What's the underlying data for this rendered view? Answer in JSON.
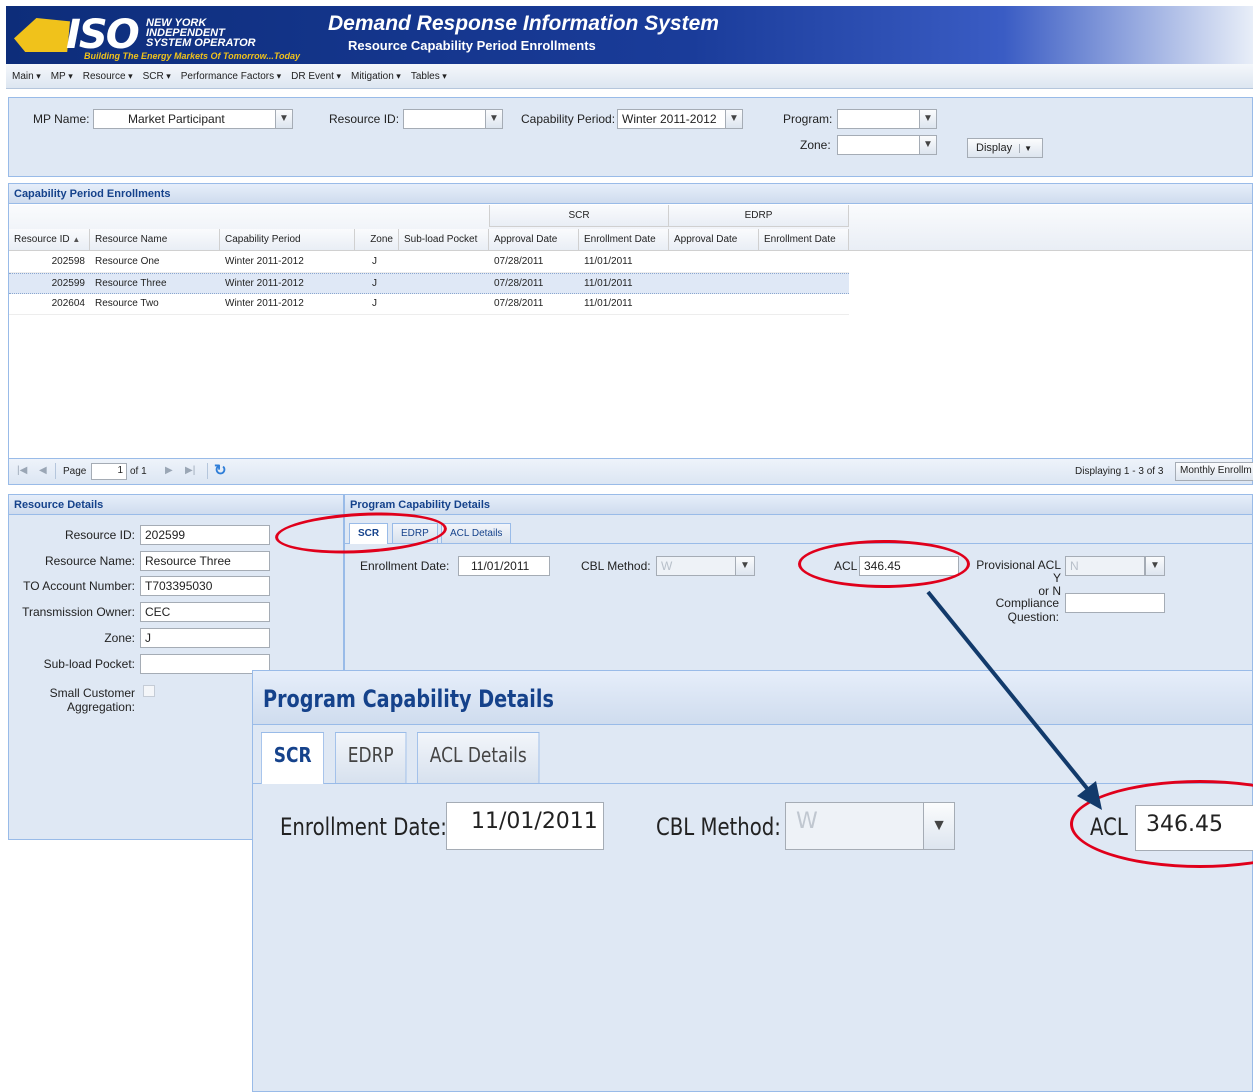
{
  "header": {
    "logo_text": "ISO",
    "logo_org_line1": "NEW YORK",
    "logo_org_line2": "INDEPENDENT",
    "logo_org_line3": "SYSTEM OPERATOR",
    "tagline": "Building The Energy Markets Of Tomorrow...Today",
    "title": "Demand Response Information System",
    "subtitle": "Resource Capability Period Enrollments"
  },
  "menu": [
    "Main",
    "MP",
    "Resource",
    "SCR",
    "Performance Factors",
    "DR Event",
    "Mitigation",
    "Tables"
  ],
  "filter": {
    "mp_label": "MP Name:",
    "mp_value": "Market Participant",
    "resource_label": "Resource ID:",
    "resource_value": "",
    "cap_label": "Capability Period:",
    "cap_value": "Winter 2011-2012",
    "program_label": "Program:",
    "program_value": "",
    "zone_label": "Zone:",
    "zone_value": "",
    "display_button": "Display"
  },
  "grid": {
    "title": "Capability Period Enrollments",
    "group_scr": "SCR",
    "group_edrp": "EDRP",
    "columns": [
      "Resource ID",
      "Resource Name",
      "Capability Period",
      "Zone",
      "Sub-load Pocket",
      "Approval Date",
      "Enrollment Date",
      "Approval Date",
      "Enrollment Date"
    ],
    "rows": [
      [
        "202598",
        "Resource One",
        "Winter 2011-2012",
        "J",
        "",
        "07/28/2011",
        "11/01/2011",
        "",
        ""
      ],
      [
        "202599",
        "Resource Three",
        "Winter 2011-2012",
        "J",
        "",
        "07/28/2011",
        "11/01/2011",
        "",
        ""
      ],
      [
        "202604",
        "Resource Two",
        "Winter 2011-2012",
        "J",
        "",
        "07/28/2011",
        "11/01/2011",
        "",
        ""
      ]
    ],
    "selected_row": 1,
    "pager": {
      "page_label": "Page",
      "page_value": "1",
      "of_label": "of 1",
      "displaying": "Displaying 1 - 3 of 3",
      "monthly_button": "Monthly Enrollm"
    }
  },
  "resource_details": {
    "title": "Resource Details",
    "id_label": "Resource ID:",
    "id_value": "202599",
    "name_label": "Resource Name:",
    "name_value": "Resource Three",
    "to_label": "TO Account Number:",
    "to_value": "T703395030",
    "owner_label": "Transmission Owner:",
    "owner_value": "CEC",
    "zone_label": "Zone:",
    "zone_value": "J",
    "subload_label": "Sub-load Pocket:",
    "subload_value": "",
    "small_label_1": "Small Customer",
    "small_label_2": "Aggregation:"
  },
  "program_details": {
    "title": "Program Capability Details",
    "tabs": [
      "SCR",
      "EDRP",
      "ACL Details"
    ],
    "enroll_label": "Enrollment Date:",
    "enroll_value": "11/01/2011",
    "cbl_label": "CBL Method:",
    "cbl_value": "W",
    "acl_label": "ACL",
    "acl_value": "346.45",
    "prov_label_1": "Provisional ACL Y",
    "prov_label_2": "or N",
    "prov_value": "N",
    "compliance_label_1": "Compliance",
    "compliance_label_2": "Question:",
    "compliance_value": ""
  },
  "zoom": {
    "title": "Program Capability Details",
    "tabs": [
      "SCR",
      "EDRP",
      "ACL Details"
    ],
    "enroll_label": "Enrollment Date:",
    "enroll_value": "11/01/2011",
    "cbl_label": "CBL Method:",
    "cbl_value": "W",
    "acl_label": "ACL",
    "acl_value": "346.45"
  },
  "colors": {
    "header_blue": "#0d2d7a",
    "panel_bg": "#dfe8f4",
    "panel_border": "#99bbe8",
    "title_text": "#15428b",
    "highlight": "#e0001b",
    "arrow": "#123a6b",
    "logo_gold": "#f0c21b"
  }
}
